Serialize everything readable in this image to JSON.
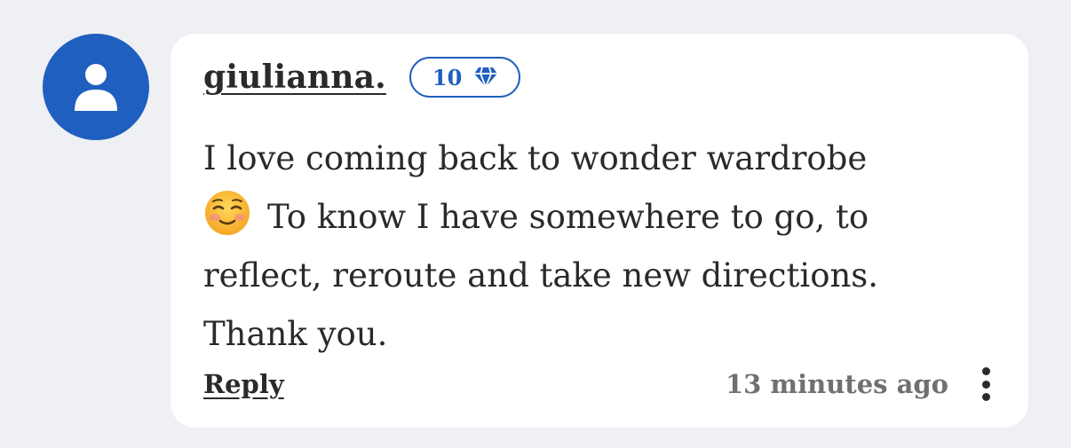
{
  "comment": {
    "username": "giulianna.",
    "badge_count": "10",
    "badge_icon": "diamond-icon",
    "avatar_icon": "user-silhouette-icon",
    "body": {
      "line1": "I love coming back to wonder wardrobe",
      "line2": "To know I have somewhere to go, to",
      "line3": "reflect, reroute and take new directions.",
      "line4": "Thank you.",
      "emoji": "smiling-face-icon"
    },
    "reply_label": "Reply",
    "timestamp": "13 minutes ago",
    "more_icon": "more-vertical-icon"
  },
  "colors": {
    "accent": "#1f5fbf",
    "background": "#eef0f4",
    "card": "#ffffff",
    "text": "#2a2a2a",
    "muted": "#707070"
  }
}
